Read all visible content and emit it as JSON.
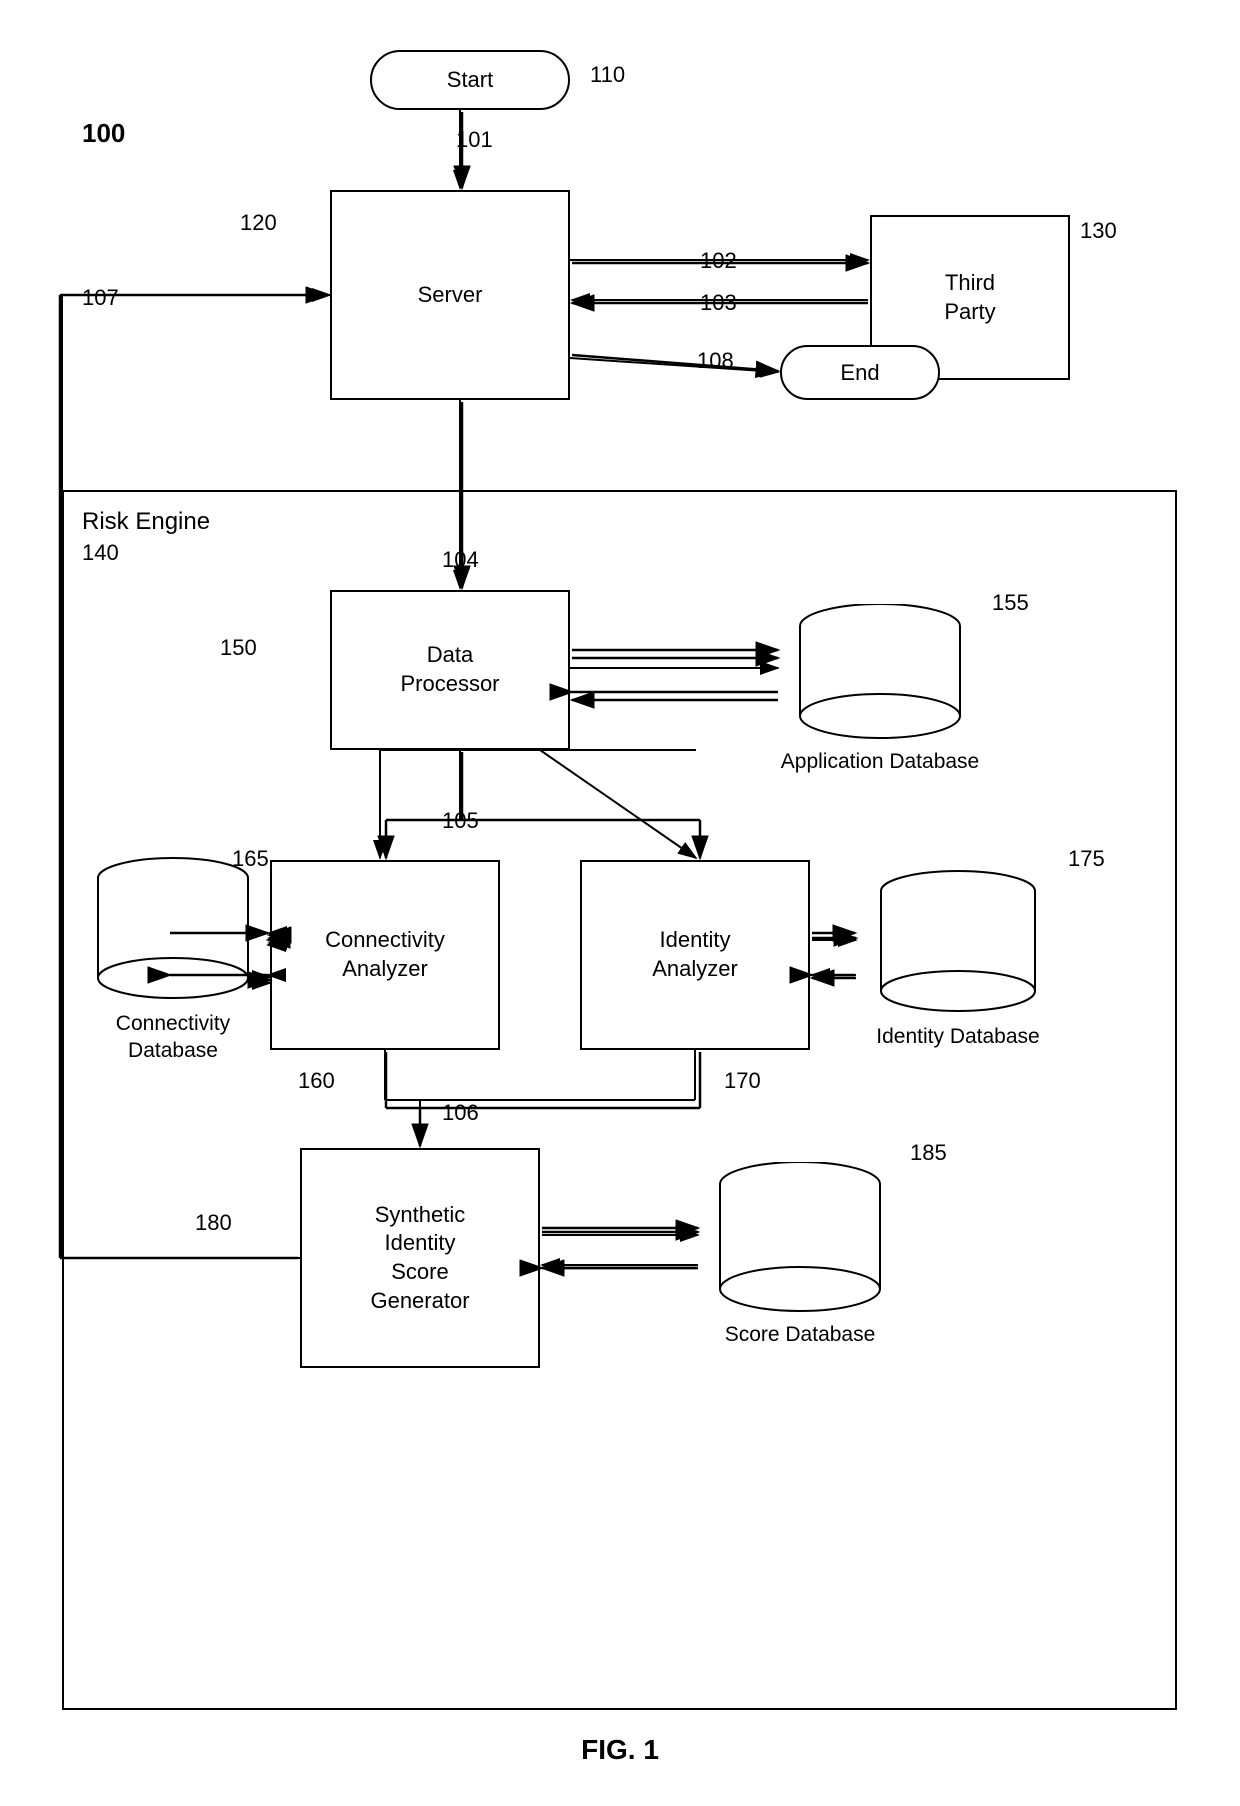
{
  "title": "FIG. 1",
  "figure_number": "FIG. 1",
  "diagram_ref": "100",
  "nodes": {
    "start": {
      "label": "Start",
      "ref": "110"
    },
    "server": {
      "label": "Server",
      "ref": "120"
    },
    "third_party": {
      "label": "Third\nParty",
      "ref": "130"
    },
    "end": {
      "label": "End",
      "ref": ""
    },
    "risk_engine": {
      "label": "Risk Engine",
      "ref": "140"
    },
    "data_processor": {
      "label": "Data\nProcessor",
      "ref": "150"
    },
    "application_db": {
      "label": "Application\nDatabase",
      "ref": "155"
    },
    "connectivity_db": {
      "label": "Connectivity\nDatabase",
      "ref": "165"
    },
    "connectivity_analyzer": {
      "label": "Connectivity\nAnalyzer",
      "ref": "160"
    },
    "identity_analyzer": {
      "label": "Identity\nAnalyzer",
      "ref": "170"
    },
    "identity_db": {
      "label": "Identity\nDatabase",
      "ref": "175"
    },
    "synthetic_score": {
      "label": "Synthetic\nIdentity\nScore\nGenerator",
      "ref": "180"
    },
    "score_db": {
      "label": "Score\nDatabase",
      "ref": "185"
    }
  },
  "arrows": {
    "refs": {
      "a101": "101",
      "a102": "102",
      "a103": "103",
      "a104": "104",
      "a105": "105",
      "a106": "106",
      "a107": "107",
      "a108": "108"
    }
  }
}
